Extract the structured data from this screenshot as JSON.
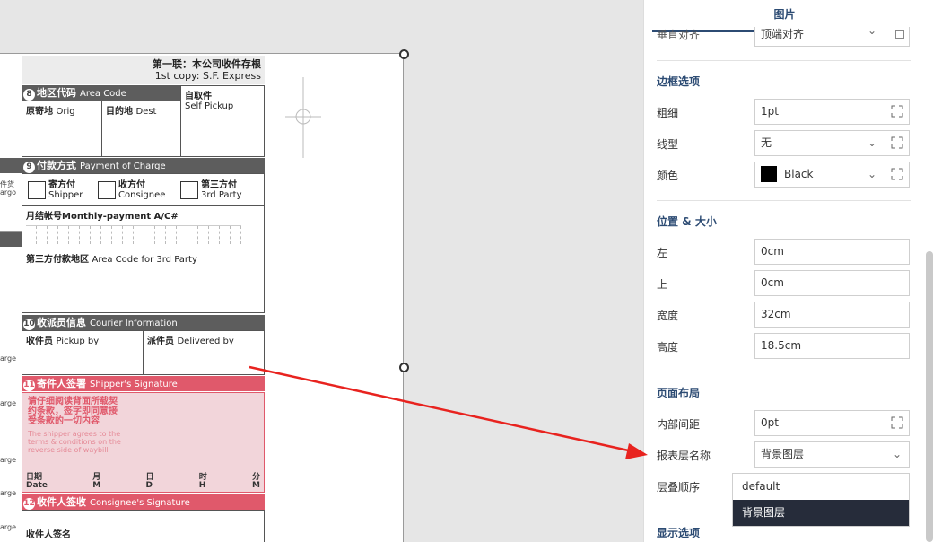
{
  "waybill": {
    "header_cn": "第一联：本公司收件存根",
    "header_en": "1st copy: S.F. Express",
    "sec8_num": "8",
    "sec8_cn": "地区代码",
    "sec8_en": "Area Code",
    "self_pickup_cn": "自取件",
    "self_pickup_en": "Self Pickup",
    "orig_cn": "原寄地",
    "orig_en": "Orig",
    "dest_cn": "目的地",
    "dest_en": "Dest",
    "sec9_num": "9",
    "sec9_cn": "付款方式",
    "sec9_en": "Payment of Charge",
    "shipper_cn": "寄方付",
    "shipper_en": "Shipper",
    "consignee_cn": "收方付",
    "consignee_en": "Consignee",
    "third_cn": "第三方付",
    "third_en": "3rd Party",
    "monthly": "月结帐号Monthly-payment A/C#",
    "third_area_cn": "第三方付款地区",
    "third_area_en": "Area Code for 3rd Party",
    "sec10_num": "10",
    "sec10_cn": "收派员信息",
    "sec10_en": "Courier Information",
    "pickup_cn": "收件员",
    "pickup_en": "Pickup by",
    "deliver_cn": "派件员",
    "deliver_en": "Delivered by",
    "sec11_num": "11",
    "sec11_cn": "寄件人签署",
    "sec11_en": "Shipper's Signature",
    "terms_cn_1": "请仔细阅读背面所载契",
    "terms_cn_2": "约条款，签字即同意接",
    "terms_cn_3": "受条款的一切内容",
    "terms_en_1": "The shipper agrees to the",
    "terms_en_2": "terms & conditions on the",
    "terms_en_3": "reverse side of waybill",
    "date_cn": "日期",
    "date_en": "Date",
    "month_cn": "月",
    "month_en": "M",
    "day_cn": "日",
    "day_en": "D",
    "hour_cn": "时",
    "hour_en": "H",
    "min_cn": "分",
    "min_en": "M",
    "sec12_num": "12",
    "sec12_cn": "收件人签收",
    "sec12_en": "Consignee's Signature",
    "recv_sign_cn": "收件人签名",
    "left_frag_1": "件货",
    "left_frag_2": "argo",
    "left_frag_3": "arge",
    "left_frag_4": "arge",
    "left_frag_5": "arge",
    "left_frag_6": "arge",
    "left_frag_7": "arge"
  },
  "panel": {
    "tab_title": "图片",
    "vertical_align_label": "垂直对齐",
    "vertical_align_value": "顶端对齐",
    "border_section": "边框选项",
    "thickness_label": "粗细",
    "thickness_value": "1pt",
    "line_type_label": "线型",
    "line_type_value": "无",
    "color_label": "颜色",
    "color_value": "Black",
    "position_section": "位置 & 大小",
    "left_label": "左",
    "left_value": "0cm",
    "top_label": "上",
    "top_value": "0cm",
    "width_label": "宽度",
    "width_value": "32cm",
    "height_label": "高度",
    "height_value": "18.5cm",
    "layout_section": "页面布局",
    "padding_label": "内部间距",
    "padding_value": "0pt",
    "layer_name_label": "报表层名称",
    "layer_name_value": "背景图层",
    "stack_order_label": "层叠顺序",
    "dropdown_options": [
      "default",
      "背景图层"
    ],
    "display_section": "显示选项"
  },
  "colors": {
    "accent": "#2c4b73",
    "selected_option_bg": "#262c3a",
    "waybill_red": "#e0596b",
    "arrow_red": "#e8231f"
  }
}
